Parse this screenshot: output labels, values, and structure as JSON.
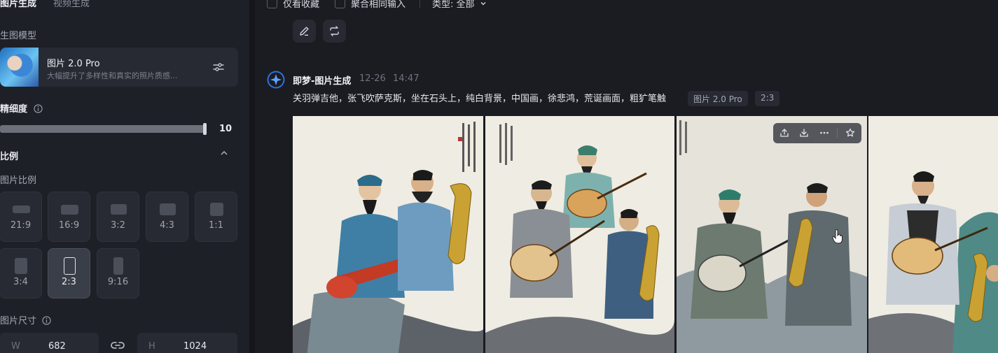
{
  "sidebar": {
    "tabs": [
      {
        "label": "图片生成",
        "active": true
      },
      {
        "label": "视频生成",
        "active": false
      }
    ],
    "model_section_label": "生图模型",
    "model": {
      "name": "图片 2.0 Pro",
      "description": "大幅提升了多样性和真实的照片质感..."
    },
    "detail_label": "精细度",
    "detail_value": "10",
    "detail_level": 1.0,
    "ratio_section_label": "比例",
    "ratio_sub_label": "图片比例",
    "ratios": [
      {
        "label": "21:9",
        "active": false
      },
      {
        "label": "16:9",
        "active": false
      },
      {
        "label": "3:2",
        "active": false
      },
      {
        "label": "4:3",
        "active": false
      },
      {
        "label": "1:1",
        "active": false
      },
      {
        "label": "3:4",
        "active": false
      },
      {
        "label": "2:3",
        "active": true
      },
      {
        "label": "9:16",
        "active": false
      }
    ],
    "size_label": "图片尺寸",
    "width_prefix": "W",
    "width_value": "682",
    "height_prefix": "H",
    "height_value": "1024"
  },
  "topbar": {
    "favorites_only": "仅看收藏",
    "aggregate_inputs": "聚合相同输入",
    "type_filter": "类型: 全部"
  },
  "message": {
    "title": "即梦-图片生成",
    "date": "12-26",
    "time": "14:47",
    "prompt": "关羽弹吉他，张飞吹萨克斯，坐在石头上，纯白背景，中国画，徐悲鸿，荒诞画面，粗犷笔触",
    "tags": [
      "图片 2.0 Pro",
      "2:3"
    ]
  },
  "colors": {
    "background": "#1a1c22",
    "sidebar": "#1e2027",
    "card": "#272a33",
    "accent": "#3f8cff"
  }
}
